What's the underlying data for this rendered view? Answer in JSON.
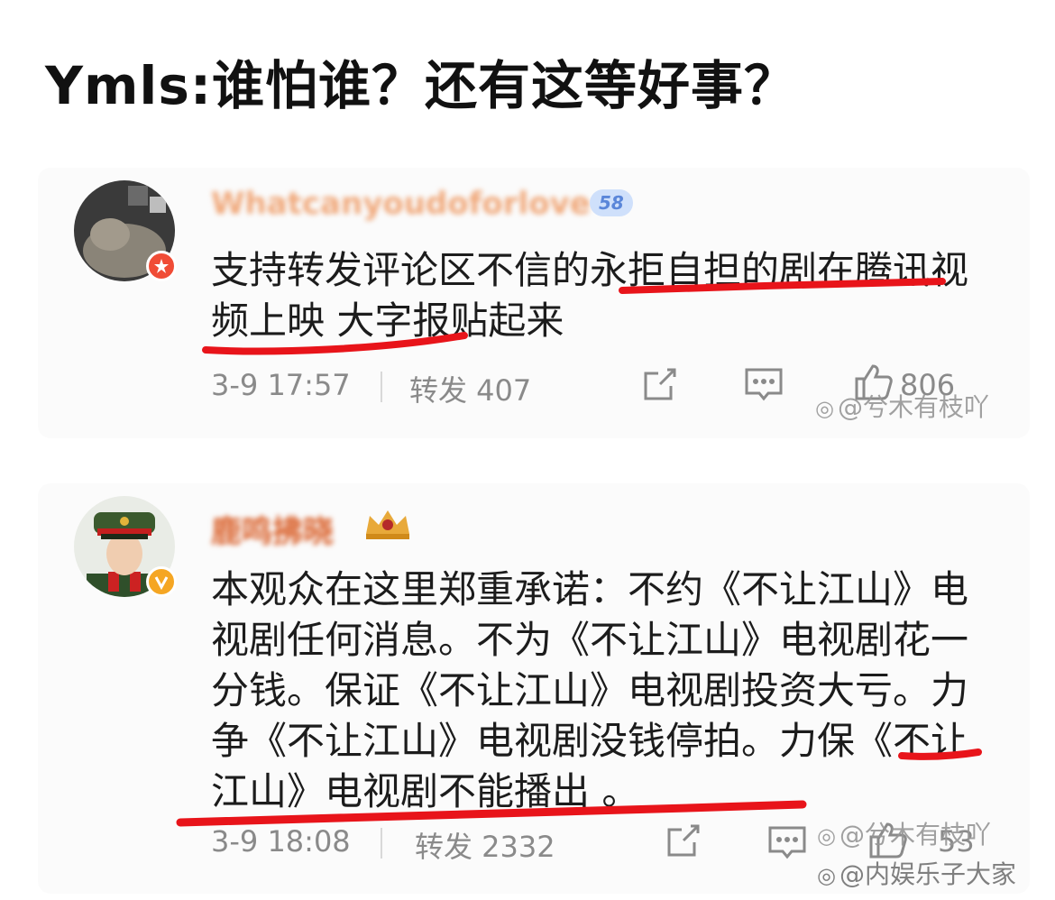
{
  "headline": "Ymls:谁怕谁？还有这等好事？",
  "posts": [
    {
      "username": "Whatcanyoudoforlove",
      "level": "58",
      "text": "支持转发评论区不信的永拒自担的剧在腾讯视频上映 大字报贴起来",
      "time": "3-9 17:57",
      "repost": "转发 407",
      "likes": "806",
      "watermark": "@兮木有枝吖"
    },
    {
      "username": "鹿鸣拂晓",
      "text": "本观众在这里郑重承诺：不约《不让江山》电视剧任何消息。不为《不让江山》电视剧花一分钱。保证《不让江山》电视剧投资大亏。力争《不让江山》电视剧没钱停拍。力保《不让江山》电视剧不能播出 。",
      "time": "3-9 18:08",
      "repost": "转发 2332",
      "likes": "53",
      "watermark": "@兮木有枝吖"
    }
  ],
  "bottom_watermark": "@内娱乐子大家",
  "colors": {
    "underline": "#e8141a",
    "meta_gray": "#8a8a8a"
  }
}
